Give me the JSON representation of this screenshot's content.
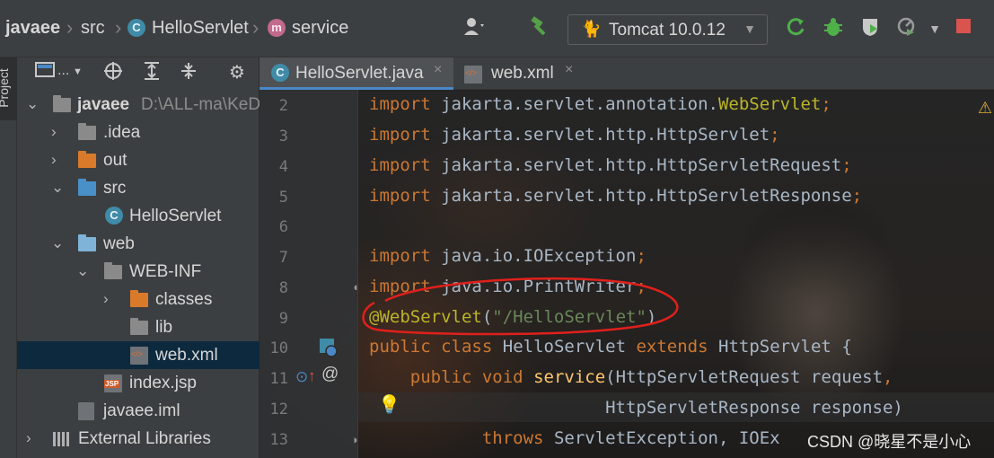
{
  "breadcrumb": {
    "project": "javaee",
    "folder": "src",
    "class_badge": "C",
    "class_name": "HelloServlet",
    "method_badge": "m",
    "method": "service"
  },
  "toolbar": {
    "run_config": "Tomcat 10.0.12",
    "icons": [
      "user-icon",
      "build-hammer-icon",
      "rerun-icon",
      "debug-bug-icon",
      "coverage-icon",
      "profiler-icon",
      "stop-icon"
    ]
  },
  "left_strip": {
    "project_tab": "Project"
  },
  "project_panel": {
    "view_label": "...",
    "tree": [
      {
        "label": "javaee",
        "path": "D:\\ALL-ma\\KeD",
        "kind": "module",
        "expanded": true
      },
      {
        "label": ".idea",
        "kind": "folder"
      },
      {
        "label": "out",
        "kind": "folder-orange"
      },
      {
        "label": "src",
        "kind": "folder-blue",
        "expanded": true
      },
      {
        "label": "HelloServlet",
        "kind": "class"
      },
      {
        "label": "web",
        "kind": "folder-web",
        "expanded": true
      },
      {
        "label": "WEB-INF",
        "kind": "folder",
        "expanded": true
      },
      {
        "label": "classes",
        "kind": "folder-orange"
      },
      {
        "label": "lib",
        "kind": "folder"
      },
      {
        "label": "web.xml",
        "kind": "xml",
        "selected": true
      },
      {
        "label": "index.jsp",
        "kind": "jsp"
      },
      {
        "label": "javaee.iml",
        "kind": "iml"
      },
      {
        "label": "External Libraries",
        "kind": "libraries"
      }
    ]
  },
  "tabs": [
    {
      "label": "HelloServlet.java",
      "active": true,
      "close": "×"
    },
    {
      "label": "web.xml",
      "active": false,
      "close": "×"
    }
  ],
  "editor": {
    "line_numbers": [
      "2",
      "3",
      "4",
      "5",
      "6",
      "7",
      "8",
      "9",
      "10",
      "11",
      "12",
      "13"
    ],
    "lines": [
      {
        "kw": "import",
        "rest": "jakarta.servlet.annotation.",
        "hl": "WebServlet",
        "end": ";"
      },
      {
        "kw": "import",
        "rest": "jakarta.servlet.http.HttpServlet",
        "end": ";"
      },
      {
        "kw": "import",
        "rest": "jakarta.servlet.http.HttpServletRequest",
        "end": ";"
      },
      {
        "kw": "import",
        "rest": "jakarta.servlet.http.HttpServletResponse",
        "end": ";"
      },
      {
        "kw": "import",
        "rest": "java.io.IOException",
        "end": ";"
      },
      {
        "kw": "import",
        "rest": "java.io.PrintWriter",
        "end": ";"
      },
      {
        "annotation": "@WebServlet",
        "open": "(",
        "string": "\"/HelloServlet\"",
        "close": ")"
      },
      {
        "kw1": "public",
        "kw2": "class",
        "name": "HelloServlet",
        "kw3": "extends",
        "parent": "HttpServlet",
        "brace": "{"
      },
      {
        "kw1": "public",
        "kw2": "void",
        "method": "service",
        "params": "(HttpServletRequest request",
        "comma": ","
      },
      {
        "params": "HttpServletResponse response)"
      },
      {
        "kw": "throws",
        "rest": "ServletException, IOEx"
      }
    ]
  },
  "watermark": "CSDN @晓星不是小心"
}
